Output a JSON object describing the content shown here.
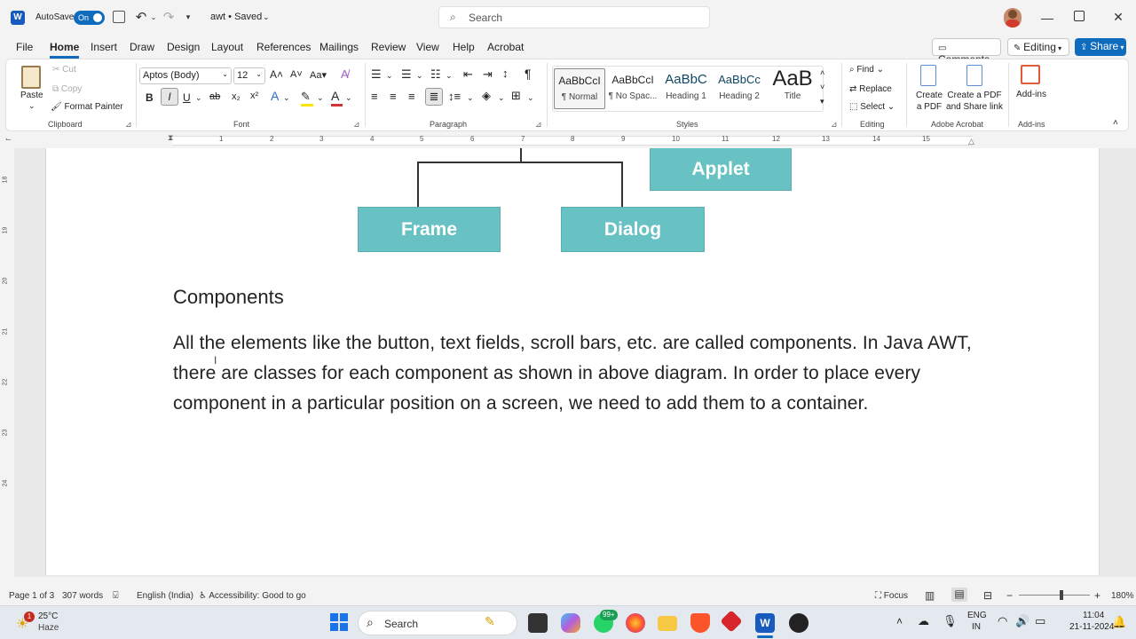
{
  "titlebar": {
    "autosave_label": "AutoSave",
    "autosave_state": "On",
    "doc_title": "awt • Saved",
    "search_placeholder": "Search"
  },
  "menu": {
    "tabs": [
      "File",
      "Home",
      "Insert",
      "Draw",
      "Design",
      "Layout",
      "References",
      "Mailings",
      "Review",
      "View",
      "Help",
      "Acrobat"
    ],
    "active": "Home",
    "comments": "Comments",
    "editing": "Editing",
    "share": "Share"
  },
  "ribbon": {
    "clipboard": {
      "paste": "Paste",
      "cut": "Cut",
      "copy": "Copy",
      "format_painter": "Format Painter",
      "label": "Clipboard"
    },
    "font": {
      "family": "Aptos (Body)",
      "size": "12",
      "label": "Font",
      "bold": "B",
      "italic": "I",
      "underline": "U",
      "strike": "ab",
      "sub": "x₂",
      "sup": "x²",
      "case": "Aa"
    },
    "paragraph": {
      "label": "Paragraph"
    },
    "styles": {
      "label": "Styles",
      "items": [
        {
          "preview": "AaBbCcI",
          "name": "¶ Normal"
        },
        {
          "preview": "AaBbCcI",
          "name": "¶ No Spac..."
        },
        {
          "preview": "AaBbC",
          "name": "Heading 1"
        },
        {
          "preview": "AaBbCc",
          "name": "Heading 2"
        },
        {
          "preview": "AaB",
          "name": "Title"
        }
      ]
    },
    "editing": {
      "find": "Find",
      "replace": "Replace",
      "select": "Select",
      "label": "Editing"
    },
    "acrobat": {
      "create_pdf": "Create a PDF",
      "create_share": "Create a PDF and Share link",
      "label": "Adobe Acrobat"
    },
    "addins": {
      "button": "Add-ins",
      "label": "Add-ins"
    }
  },
  "ruler": {
    "h_numbers": [
      "1",
      "1",
      "2",
      "3",
      "4",
      "5",
      "6",
      "7",
      "8",
      "9",
      "10",
      "11",
      "12",
      "13",
      "14",
      "15"
    ],
    "v_numbers": [
      "18",
      "19",
      "20",
      "21",
      "22",
      "23",
      "24"
    ]
  },
  "document": {
    "diagram": {
      "applet": "Applet",
      "frame": "Frame",
      "dialog": "Dialog"
    },
    "heading": "Components",
    "paragraph": "All the elements like the button, text fields, scroll bars, etc. are called components. In Java AWT, there are classes for each component as shown in above diagram. In order to place every component in a particular position on a screen, we need to add them to a container."
  },
  "status": {
    "page": "Page 1 of 3",
    "words": "307 words",
    "language": "English (India)",
    "accessibility": "Accessibility: Good to go",
    "focus": "Focus",
    "zoom": "180%"
  },
  "taskbar": {
    "weather_temp": "25°C",
    "weather_desc": "Haze",
    "weather_badge": "1",
    "search": "Search",
    "whatsapp_badge": "99+",
    "lang1": "ENG",
    "lang2": "IN",
    "time": "11:04",
    "date": "21-11-2024"
  },
  "colors": {
    "accent": "#0f6cbd",
    "diagram_box": "#68c1c2"
  }
}
